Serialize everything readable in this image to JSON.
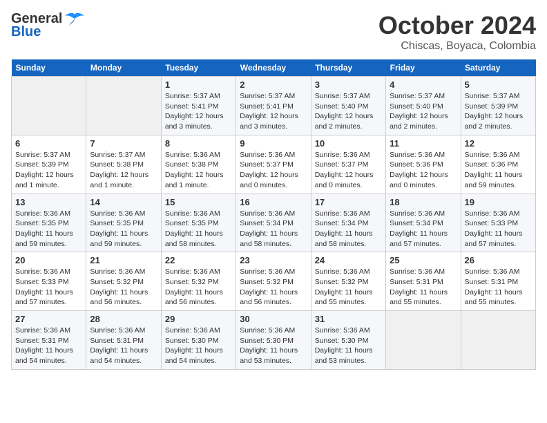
{
  "logo": {
    "line1": "General",
    "line2": "Blue"
  },
  "title": "October 2024",
  "subtitle": "Chiscas, Boyaca, Colombia",
  "days_of_week": [
    "Sunday",
    "Monday",
    "Tuesday",
    "Wednesday",
    "Thursday",
    "Friday",
    "Saturday"
  ],
  "weeks": [
    [
      {
        "day": "",
        "info": ""
      },
      {
        "day": "",
        "info": ""
      },
      {
        "day": "1",
        "info": "Sunrise: 5:37 AM\nSunset: 5:41 PM\nDaylight: 12 hours\nand 3 minutes."
      },
      {
        "day": "2",
        "info": "Sunrise: 5:37 AM\nSunset: 5:41 PM\nDaylight: 12 hours\nand 3 minutes."
      },
      {
        "day": "3",
        "info": "Sunrise: 5:37 AM\nSunset: 5:40 PM\nDaylight: 12 hours\nand 2 minutes."
      },
      {
        "day": "4",
        "info": "Sunrise: 5:37 AM\nSunset: 5:40 PM\nDaylight: 12 hours\nand 2 minutes."
      },
      {
        "day": "5",
        "info": "Sunrise: 5:37 AM\nSunset: 5:39 PM\nDaylight: 12 hours\nand 2 minutes."
      }
    ],
    [
      {
        "day": "6",
        "info": "Sunrise: 5:37 AM\nSunset: 5:39 PM\nDaylight: 12 hours\nand 1 minute."
      },
      {
        "day": "7",
        "info": "Sunrise: 5:37 AM\nSunset: 5:38 PM\nDaylight: 12 hours\nand 1 minute."
      },
      {
        "day": "8",
        "info": "Sunrise: 5:36 AM\nSunset: 5:38 PM\nDaylight: 12 hours\nand 1 minute."
      },
      {
        "day": "9",
        "info": "Sunrise: 5:36 AM\nSunset: 5:37 PM\nDaylight: 12 hours\nand 0 minutes."
      },
      {
        "day": "10",
        "info": "Sunrise: 5:36 AM\nSunset: 5:37 PM\nDaylight: 12 hours\nand 0 minutes."
      },
      {
        "day": "11",
        "info": "Sunrise: 5:36 AM\nSunset: 5:36 PM\nDaylight: 12 hours\nand 0 minutes."
      },
      {
        "day": "12",
        "info": "Sunrise: 5:36 AM\nSunset: 5:36 PM\nDaylight: 11 hours\nand 59 minutes."
      }
    ],
    [
      {
        "day": "13",
        "info": "Sunrise: 5:36 AM\nSunset: 5:35 PM\nDaylight: 11 hours\nand 59 minutes."
      },
      {
        "day": "14",
        "info": "Sunrise: 5:36 AM\nSunset: 5:35 PM\nDaylight: 11 hours\nand 59 minutes."
      },
      {
        "day": "15",
        "info": "Sunrise: 5:36 AM\nSunset: 5:35 PM\nDaylight: 11 hours\nand 58 minutes."
      },
      {
        "day": "16",
        "info": "Sunrise: 5:36 AM\nSunset: 5:34 PM\nDaylight: 11 hours\nand 58 minutes."
      },
      {
        "day": "17",
        "info": "Sunrise: 5:36 AM\nSunset: 5:34 PM\nDaylight: 11 hours\nand 58 minutes."
      },
      {
        "day": "18",
        "info": "Sunrise: 5:36 AM\nSunset: 5:34 PM\nDaylight: 11 hours\nand 57 minutes."
      },
      {
        "day": "19",
        "info": "Sunrise: 5:36 AM\nSunset: 5:33 PM\nDaylight: 11 hours\nand 57 minutes."
      }
    ],
    [
      {
        "day": "20",
        "info": "Sunrise: 5:36 AM\nSunset: 5:33 PM\nDaylight: 11 hours\nand 57 minutes."
      },
      {
        "day": "21",
        "info": "Sunrise: 5:36 AM\nSunset: 5:32 PM\nDaylight: 11 hours\nand 56 minutes."
      },
      {
        "day": "22",
        "info": "Sunrise: 5:36 AM\nSunset: 5:32 PM\nDaylight: 11 hours\nand 56 minutes."
      },
      {
        "day": "23",
        "info": "Sunrise: 5:36 AM\nSunset: 5:32 PM\nDaylight: 11 hours\nand 56 minutes."
      },
      {
        "day": "24",
        "info": "Sunrise: 5:36 AM\nSunset: 5:32 PM\nDaylight: 11 hours\nand 55 minutes."
      },
      {
        "day": "25",
        "info": "Sunrise: 5:36 AM\nSunset: 5:31 PM\nDaylight: 11 hours\nand 55 minutes."
      },
      {
        "day": "26",
        "info": "Sunrise: 5:36 AM\nSunset: 5:31 PM\nDaylight: 11 hours\nand 55 minutes."
      }
    ],
    [
      {
        "day": "27",
        "info": "Sunrise: 5:36 AM\nSunset: 5:31 PM\nDaylight: 11 hours\nand 54 minutes."
      },
      {
        "day": "28",
        "info": "Sunrise: 5:36 AM\nSunset: 5:31 PM\nDaylight: 11 hours\nand 54 minutes."
      },
      {
        "day": "29",
        "info": "Sunrise: 5:36 AM\nSunset: 5:30 PM\nDaylight: 11 hours\nand 54 minutes."
      },
      {
        "day": "30",
        "info": "Sunrise: 5:36 AM\nSunset: 5:30 PM\nDaylight: 11 hours\nand 53 minutes."
      },
      {
        "day": "31",
        "info": "Sunrise: 5:36 AM\nSunset: 5:30 PM\nDaylight: 11 hours\nand 53 minutes."
      },
      {
        "day": "",
        "info": ""
      },
      {
        "day": "",
        "info": ""
      }
    ]
  ]
}
